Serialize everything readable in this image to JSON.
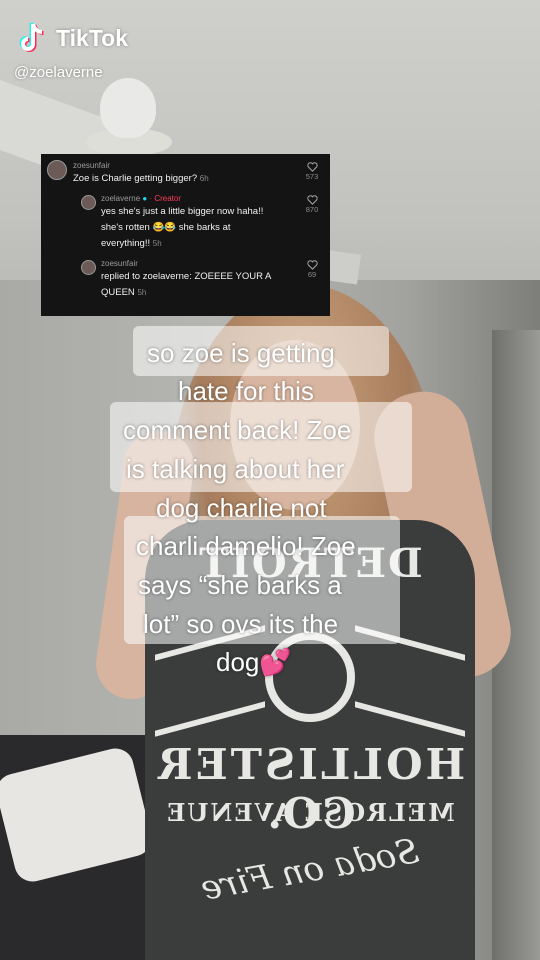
{
  "watermark": {
    "brand": "TikTok",
    "handle": "@zoelaverne",
    "logo_icon": "tiktok-logo-icon"
  },
  "comments_card": {
    "items": [
      {
        "user": "zoesunfair",
        "text": "Zoe is Charlie getting bigger?",
        "time": "6h",
        "likes": "573"
      },
      {
        "user": "zoelaverne",
        "badge": "· Creator",
        "text_lines": [
          "yes she's just a little bigger now haha!!",
          "she's rotten 😂😂 she barks at",
          "everything!!"
        ],
        "time": "5h",
        "likes": "870"
      },
      {
        "user": "zoesunfair",
        "text_lines": [
          "replied to zoelaverne: ZOEEEE YOUR A",
          "QUEEN"
        ],
        "time": "5h",
        "likes": "69"
      }
    ]
  },
  "caption": {
    "lines": [
      "so zoe is getting",
      "hate for this",
      "comment back! Zoe",
      "is talking about her",
      "dog charlie not",
      "charli damelio! Zoe",
      "says “she barks a",
      "lot” so ovs its the",
      "dog💕"
    ]
  },
  "shirt_print": {
    "top": "DETROIT",
    "main": "HOLLISTER CO.",
    "sub": "MELROSE AVENUE",
    "script": "Soda on Fire"
  },
  "colors": {
    "comment_bg": "#141414",
    "creator_red": "#ff3b5c",
    "verified_cyan": "#20d5ec",
    "caption_text": "#ffffff"
  }
}
